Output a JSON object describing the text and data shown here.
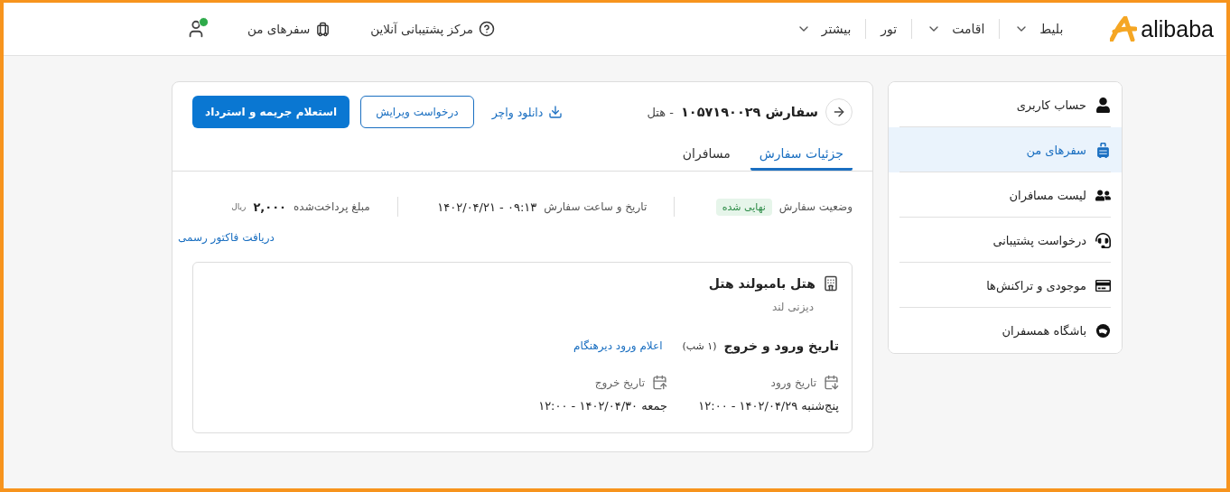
{
  "header": {
    "logo": "alibaba",
    "nav": [
      {
        "label": "بلیط",
        "dropdown": true
      },
      {
        "label": "اقامت",
        "dropdown": true
      },
      {
        "label": "تور",
        "dropdown": false
      },
      {
        "label": "بیشتر",
        "dropdown": true
      }
    ],
    "support": "مرکز پشتیبانی آنلاین",
    "trips": "سفرهای من",
    "user_verified": true
  },
  "sidebar": {
    "items": [
      {
        "label": "حساب کاربری",
        "selected": false
      },
      {
        "label": "سفرهای من",
        "selected": true
      },
      {
        "label": "لیست مسافران",
        "selected": false
      },
      {
        "label": "درخواست پشتیبانی",
        "selected": false
      },
      {
        "label": "موجودی و تراکنش‌ها",
        "selected": false
      },
      {
        "label": "باشگاه همسفران",
        "selected": false
      }
    ]
  },
  "order": {
    "title": "سفارش ۱۰۵۷۱۹۰۰۲۹",
    "type": "- هتل",
    "download": "دانلود واچر",
    "edit_button": "درخواست ویرایش",
    "refund_button": "استعلام جریمه و استرداد"
  },
  "tabs": [
    {
      "label": "جزئیات سفارش",
      "selected": true
    },
    {
      "label": "مسافران",
      "selected": false
    }
  ],
  "summary": {
    "status_label": "وضعیت سفارش",
    "status": "نهایی شده",
    "datetime_label": "تاریخ و ساعت سفارش",
    "datetime": "۰۹:۱۳ - ۱۴۰۲/۰۴/۲۱",
    "amount_label": "مبلغ پرداخت‌شده",
    "amount": "۲,۰۰۰",
    "currency": "ریال",
    "invoice_link": "دریافت فاکتور رسمی"
  },
  "hotel": {
    "name": "هتل بامبولند هتل",
    "location": "دیزنی لند",
    "dates_title": "تاریخ ورود و خروج",
    "nights": "(۱ شب)",
    "late_checkin": "اعلام ورود دیرهنگام",
    "checkin_label": "تاریخ ورود",
    "checkin": "پنج‌شنبه ۱۴۰۲/۰۴/۲۹ - ۱۲:۰۰",
    "checkout_label": "تاریخ خروج",
    "checkout": "جمعه ۱۴۰۲/۰۴/۳۰ - ۱۲:۰۰"
  }
}
